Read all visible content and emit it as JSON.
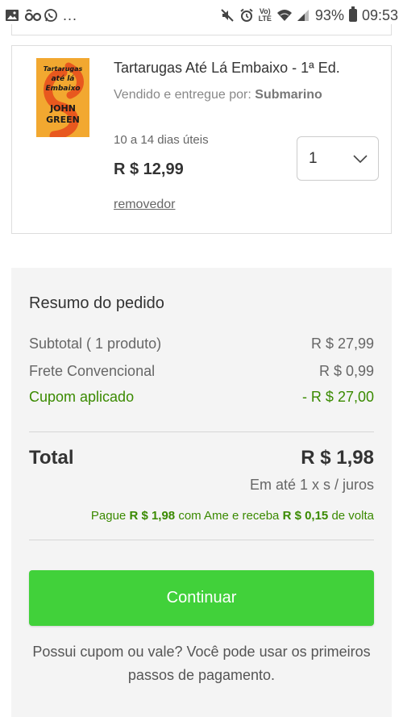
{
  "status_bar": {
    "overflow": "...",
    "lte_top": "Vo)",
    "lte_bottom": "LTE",
    "battery_percent": "93%",
    "time": "09:53",
    "icons": [
      "image-icon",
      "voicemail-icon",
      "whatsapp-icon",
      "mute-icon",
      "alarm-icon",
      "lte-icon",
      "wifi-icon",
      "signal-icon",
      "battery-icon"
    ]
  },
  "product": {
    "title": "Tartarugas Até Lá Embaixo - 1ª Ed.",
    "seller_label": "Vendido e entregue por:",
    "seller_name": "Submarino",
    "delivery": "10 a 14 dias úteis",
    "price": "R $ 12,99",
    "remove_label": "removedor",
    "quantity": "1",
    "cover_lines": [
      "Tartarugas",
      "até lá",
      "Embaixo",
      "JOHN",
      "GREEN"
    ]
  },
  "summary": {
    "heading": "Resumo do pedido",
    "subtotal_label": "Subtotal ( 1 produto)",
    "subtotal_value": "R $ 27,99",
    "shipping_label": "Frete Convencional",
    "shipping_value": "R $ 0,99",
    "coupon_label": "Cupom aplicado",
    "coupon_value": "- R $ 27,00",
    "total_label": "Total",
    "total_value": "R $ 1,98",
    "installments": "Em até 1 x s / juros",
    "ame_prefix": "Pague",
    "ame_amount": "R $ 1,98",
    "ame_middle": "com Ame e receba",
    "ame_cashback": "R $ 0,15",
    "ame_suffix": "de volta",
    "continue_label": "Continuar",
    "footnote": "Possui cupom ou vale? Você pode usar os primeiros passos de pagamento."
  },
  "colors": {
    "accent_green": "#41d13a",
    "coupon_green": "#3a8a00",
    "summary_bg": "#f4f4f4"
  }
}
